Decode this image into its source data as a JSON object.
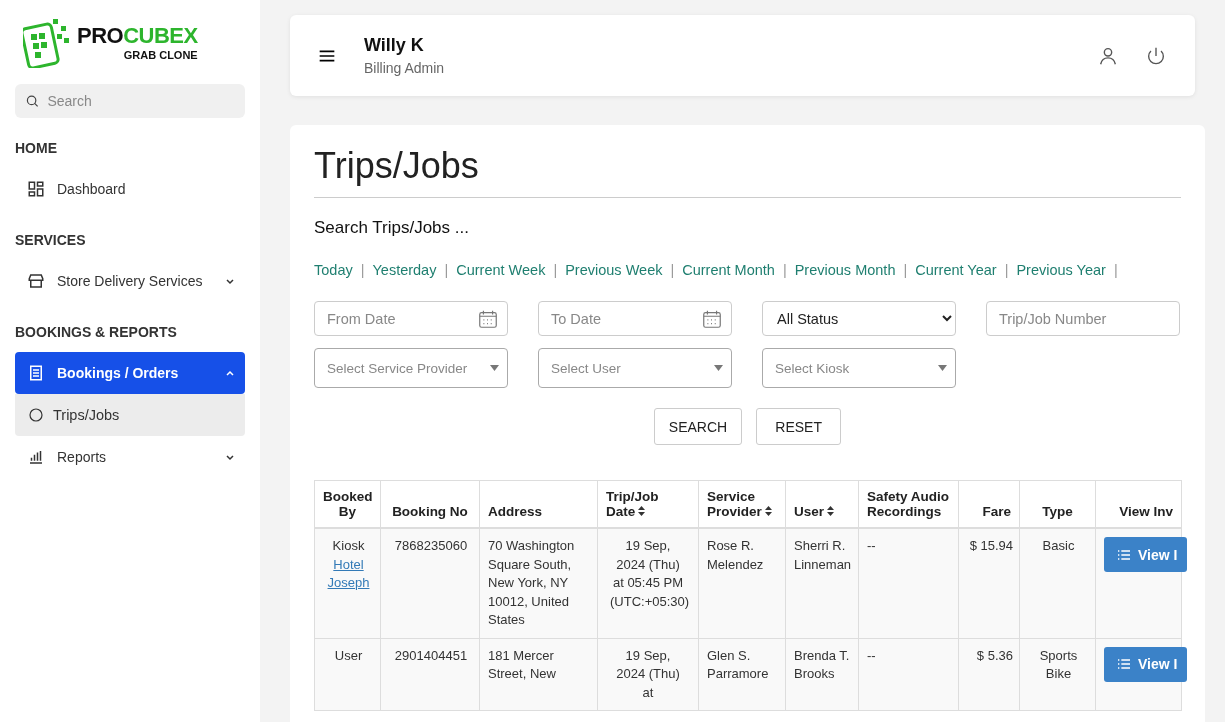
{
  "sidebar": {
    "logo": {
      "brand_dark": "PRO",
      "brand_green": "CUBEX",
      "tagline": "GRAB CLONE"
    },
    "search": {
      "placeholder": "Search"
    },
    "sections": [
      {
        "heading": "HOME",
        "items": [
          {
            "label": "Dashboard",
            "kind": "dashboard",
            "selected": false
          }
        ]
      },
      {
        "heading": "SERVICES",
        "items": [
          {
            "label": "Store Delivery Services",
            "kind": "store",
            "selected": false,
            "expanded": false
          }
        ]
      },
      {
        "heading": "BOOKINGS & REPORTS",
        "items": [
          {
            "label": "Bookings / Orders",
            "kind": "bookings",
            "selected": true,
            "expanded": true,
            "children": [
              {
                "label": "Trips/Jobs",
                "selected": true
              }
            ]
          },
          {
            "label": "Reports",
            "kind": "reports",
            "selected": false,
            "expanded": false
          }
        ]
      }
    ]
  },
  "header": {
    "user_name": "Willy K",
    "user_role": "Billing Admin"
  },
  "page": {
    "title": "Trips/Jobs",
    "search_heading": "Search Trips/Jobs ...",
    "quick_ranges": [
      "Today",
      "Yesterday",
      "Current Week",
      "Previous Week",
      "Current Month",
      "Previous Month",
      "Current Year",
      "Previous Year"
    ],
    "range_separator": "|",
    "filters": [
      {
        "kind": "date",
        "placeholder": "From Date"
      },
      {
        "kind": "date",
        "placeholder": "To Date"
      },
      {
        "kind": "select",
        "value": "All Status"
      },
      {
        "kind": "text",
        "placeholder": "Trip/Job Number"
      },
      {
        "kind": "combo",
        "placeholder": "Select Service Provider"
      },
      {
        "kind": "combo",
        "placeholder": "Select User"
      },
      {
        "kind": "combo",
        "placeholder": "Select Kiosk"
      }
    ],
    "buttons": [
      "SEARCH",
      "RESET"
    ]
  },
  "table": {
    "columns": [
      {
        "label": "Booked By",
        "sortable": false
      },
      {
        "label": "Booking No",
        "sortable": false
      },
      {
        "label": "Address",
        "sortable": false
      },
      {
        "label": "Trip/Job Date",
        "sortable": true
      },
      {
        "label": "Service Provider",
        "sortable": true
      },
      {
        "label": "User",
        "sortable": true
      },
      {
        "label": "Safety Audio Recordings",
        "sortable": false
      },
      {
        "label": "Fare",
        "sortable": false
      },
      {
        "label": "Type",
        "sortable": false
      },
      {
        "label": "View Inv",
        "sortable": false
      }
    ],
    "rows": [
      {
        "booked_by": "Kiosk",
        "booked_by_link": "Hotel Joseph",
        "booking_no": "7868235060",
        "address": "70 Washington Square South, New York, NY 10012, United States",
        "date": "19 Sep, 2024 (Thu) at 05:45 PM (UTC:+05:30)",
        "provider": "Rose R. Melendez",
        "user": "Sherri R. Linneman",
        "audio": "--",
        "fare": "$ 15.94",
        "type": "Basic",
        "action": "View I"
      },
      {
        "booked_by": "User",
        "booking_no": "2901404451",
        "address": "181 Mercer Street, New",
        "date": "19 Sep, 2024 (Thu) at",
        "provider": "Glen S. Parramore",
        "user": "Brenda T. Brooks",
        "audio": "--",
        "fare": "$ 5.36",
        "type": "Sports Bike",
        "action": "View I"
      }
    ]
  }
}
